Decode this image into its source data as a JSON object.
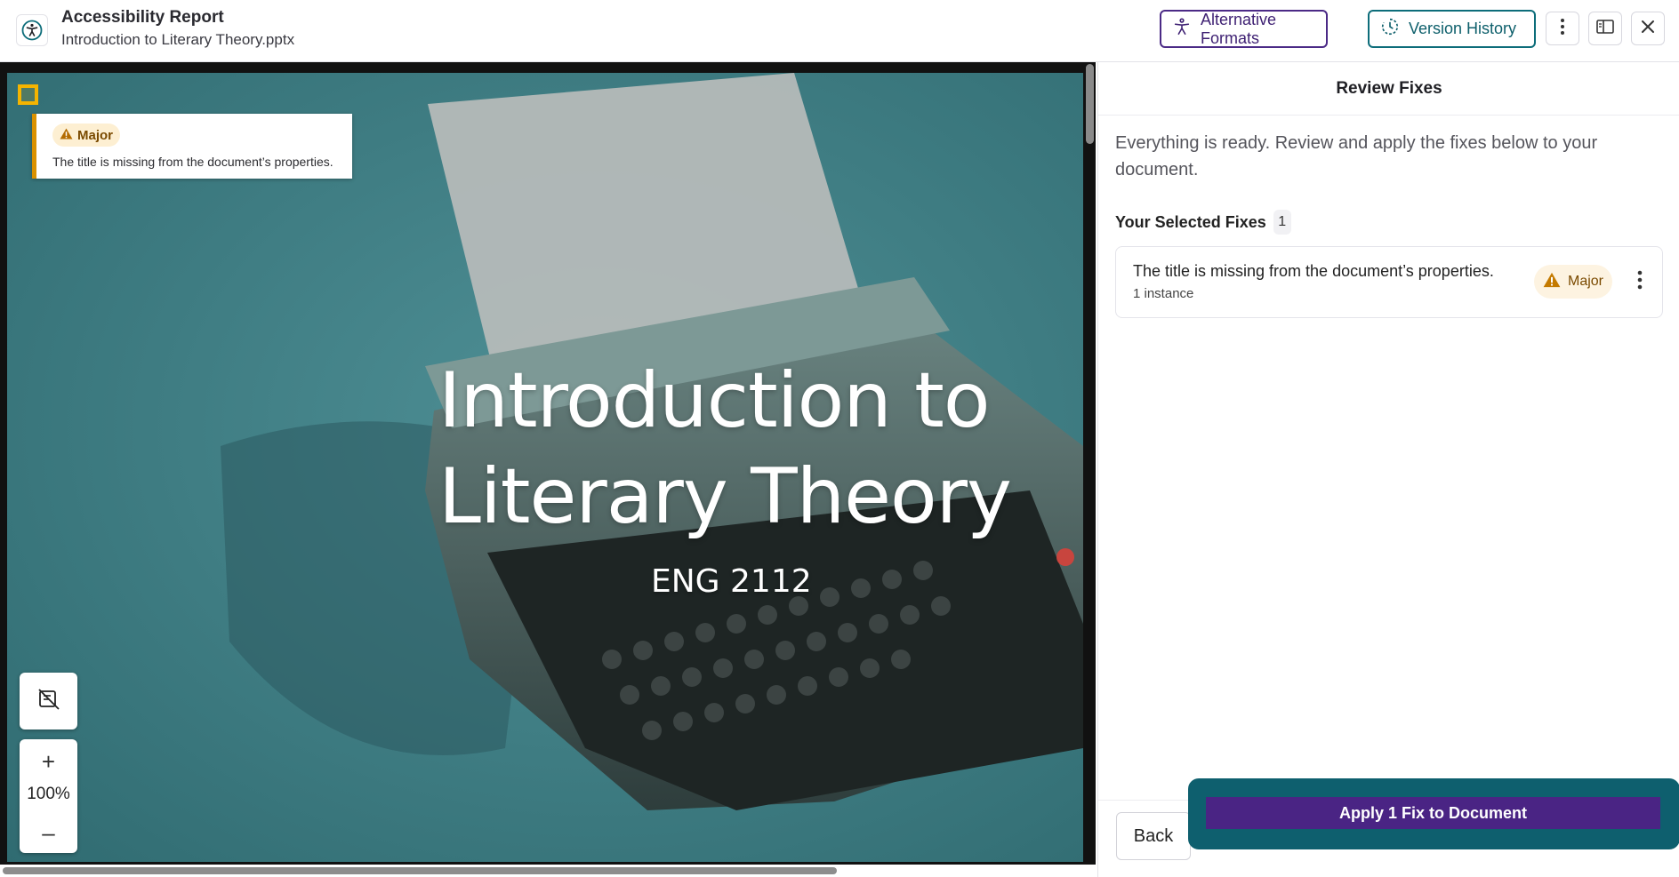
{
  "header": {
    "title": "Accessibility Report",
    "filename": "Introduction to Literary Theory.pptx",
    "alt_formats_label": "Alternative Formats",
    "version_history_label": "Version History"
  },
  "slide": {
    "title_line1": "Introduction to",
    "title_line2": "Literary Theory",
    "subtitle": "ENG 2112"
  },
  "issue_overlay": {
    "severity": "Major",
    "text": "The title is missing from the document’s properties."
  },
  "zoom": {
    "level": "100%"
  },
  "panel": {
    "title": "Review Fixes",
    "description": "Everything is ready. Review and apply the fixes below to your document.",
    "selected_heading": "Your Selected Fixes",
    "selected_count": "1",
    "fixes": [
      {
        "title": "The title is missing from the document’s properties.",
        "instances": "1 instance",
        "severity": "Major"
      }
    ],
    "back_label": "Back",
    "apply_label": "Apply 1 Fix to Document"
  },
  "colors": {
    "brand_purple": "#4a2484",
    "teal": "#0e5f6e",
    "major_orange": "#d99100"
  }
}
